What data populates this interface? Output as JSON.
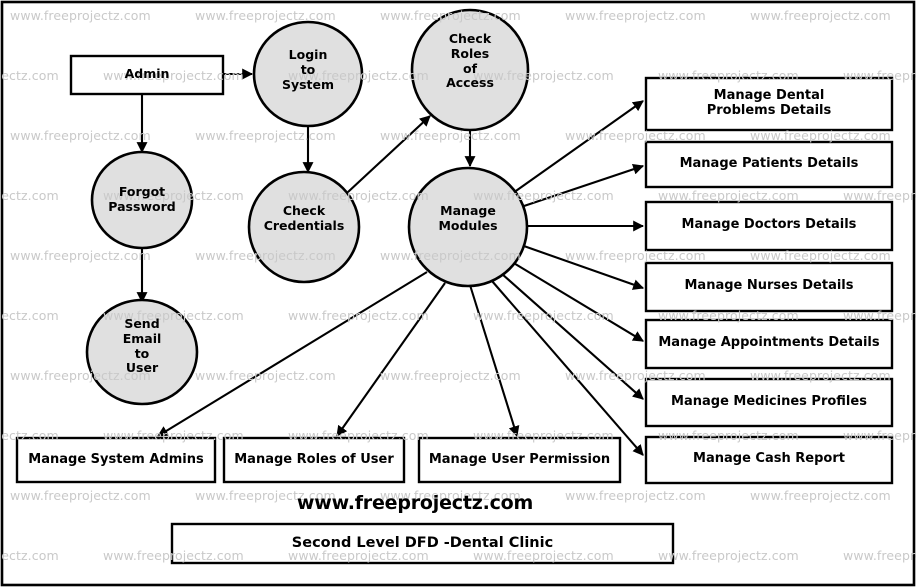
{
  "diagram": {
    "title": "Second Level DFD -Dental Clinic",
    "brand": "www.freeprojectz.com",
    "watermark_text": "www.freeprojectz.com",
    "colors": {
      "process_fill": "#e0e0e0",
      "entity_fill": "#ffffff",
      "stroke": "#000000",
      "watermark": "#c9c9c9",
      "background": "#ffffff"
    },
    "entities": [
      {
        "id": "admin",
        "label": "Admin",
        "shape": "rectangle"
      }
    ],
    "processes": [
      {
        "id": "login",
        "label": "Login\nto\nSystem",
        "shape": "circle"
      },
      {
        "id": "check_roles",
        "label": "Check\nRoles\nof\nAccess",
        "shape": "circle"
      },
      {
        "id": "forgot",
        "label": "Forgot\nPassword",
        "shape": "circle"
      },
      {
        "id": "credentials",
        "label": "Check\nCredentials",
        "shape": "circle"
      },
      {
        "id": "modules",
        "label": "Manage\nModules",
        "shape": "circle"
      },
      {
        "id": "send_email",
        "label": "Send\nEmail\nto\nUser",
        "shape": "circle"
      }
    ],
    "right_modules": [
      {
        "id": "dental_problems",
        "label": "Manage Dental\nProblems Details"
      },
      {
        "id": "patients",
        "label": "Manage Patients Details"
      },
      {
        "id": "doctors",
        "label": "Manage Doctors Details"
      },
      {
        "id": "nurses",
        "label": "Manage Nurses Details"
      },
      {
        "id": "appointments",
        "label": "Manage Appointments Details"
      },
      {
        "id": "medicines",
        "label": "Manage Medicines Profiles"
      },
      {
        "id": "cash_report",
        "label": "Manage Cash Report"
      }
    ],
    "bottom_modules": [
      {
        "id": "system_admins",
        "label": "Manage System Admins"
      },
      {
        "id": "roles_of_user",
        "label": "Manage Roles of User"
      },
      {
        "id": "user_permission",
        "label": "Manage User Permission"
      }
    ],
    "flows": [
      {
        "from": "admin",
        "to": "login"
      },
      {
        "from": "admin",
        "to": "forgot"
      },
      {
        "from": "login",
        "to": "credentials"
      },
      {
        "from": "forgot",
        "to": "send_email"
      },
      {
        "from": "credentials",
        "to": "check_roles"
      },
      {
        "from": "check_roles",
        "to": "modules"
      },
      {
        "from": "modules",
        "to": "dental_problems"
      },
      {
        "from": "modules",
        "to": "patients"
      },
      {
        "from": "modules",
        "to": "doctors"
      },
      {
        "from": "modules",
        "to": "nurses"
      },
      {
        "from": "modules",
        "to": "appointments"
      },
      {
        "from": "modules",
        "to": "medicines"
      },
      {
        "from": "modules",
        "to": "cash_report"
      },
      {
        "from": "modules",
        "to": "system_admins"
      },
      {
        "from": "modules",
        "to": "roles_of_user"
      },
      {
        "from": "modules",
        "to": "user_permission"
      }
    ]
  }
}
